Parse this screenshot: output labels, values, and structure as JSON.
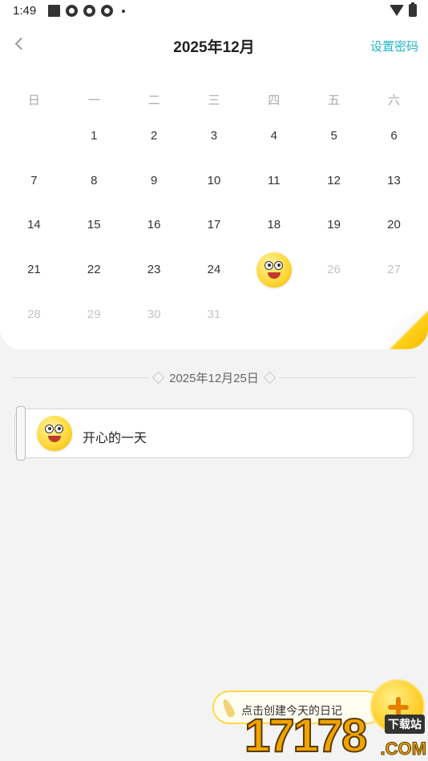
{
  "status_bar": {
    "time": "1:49"
  },
  "header": {
    "month_title": "2025年12月",
    "set_password": "设置密码"
  },
  "weekdays": [
    "日",
    "一",
    "二",
    "三",
    "四",
    "五",
    "六"
  ],
  "calendar": {
    "leading_empty": 1,
    "days": [
      {
        "label": "1",
        "state": "past"
      },
      {
        "label": "2",
        "state": "past"
      },
      {
        "label": "3",
        "state": "past"
      },
      {
        "label": "4",
        "state": "past"
      },
      {
        "label": "5",
        "state": "past"
      },
      {
        "label": "6",
        "state": "past"
      },
      {
        "label": "7",
        "state": "past"
      },
      {
        "label": "8",
        "state": "past"
      },
      {
        "label": "9",
        "state": "past"
      },
      {
        "label": "10",
        "state": "past"
      },
      {
        "label": "11",
        "state": "past"
      },
      {
        "label": "12",
        "state": "past"
      },
      {
        "label": "13",
        "state": "past"
      },
      {
        "label": "14",
        "state": "past"
      },
      {
        "label": "15",
        "state": "past"
      },
      {
        "label": "16",
        "state": "past"
      },
      {
        "label": "17",
        "state": "past"
      },
      {
        "label": "18",
        "state": "past"
      },
      {
        "label": "19",
        "state": "past"
      },
      {
        "label": "20",
        "state": "past"
      },
      {
        "label": "21",
        "state": "past"
      },
      {
        "label": "22",
        "state": "past"
      },
      {
        "label": "23",
        "state": "past"
      },
      {
        "label": "24",
        "state": "past"
      },
      {
        "label": "25",
        "state": "today-emoji"
      },
      {
        "label": "26",
        "state": "future"
      },
      {
        "label": "27",
        "state": "future"
      },
      {
        "label": "28",
        "state": "future"
      },
      {
        "label": "29",
        "state": "future"
      },
      {
        "label": "30",
        "state": "future"
      },
      {
        "label": "31",
        "state": "future"
      }
    ]
  },
  "selected_date": "2025年12月25日",
  "entry": {
    "mood_icon": "happy-face-icon",
    "text": "开心的一天"
  },
  "create": {
    "label": "点击创建今天的日记",
    "icon": "plus-icon"
  },
  "watermark": {
    "number": "17178",
    "site": "下载站",
    "com": ".COM"
  },
  "colors": {
    "accent": "#20b6c8",
    "emoji": "#ffd93a",
    "create_border": "#ffd84a"
  }
}
